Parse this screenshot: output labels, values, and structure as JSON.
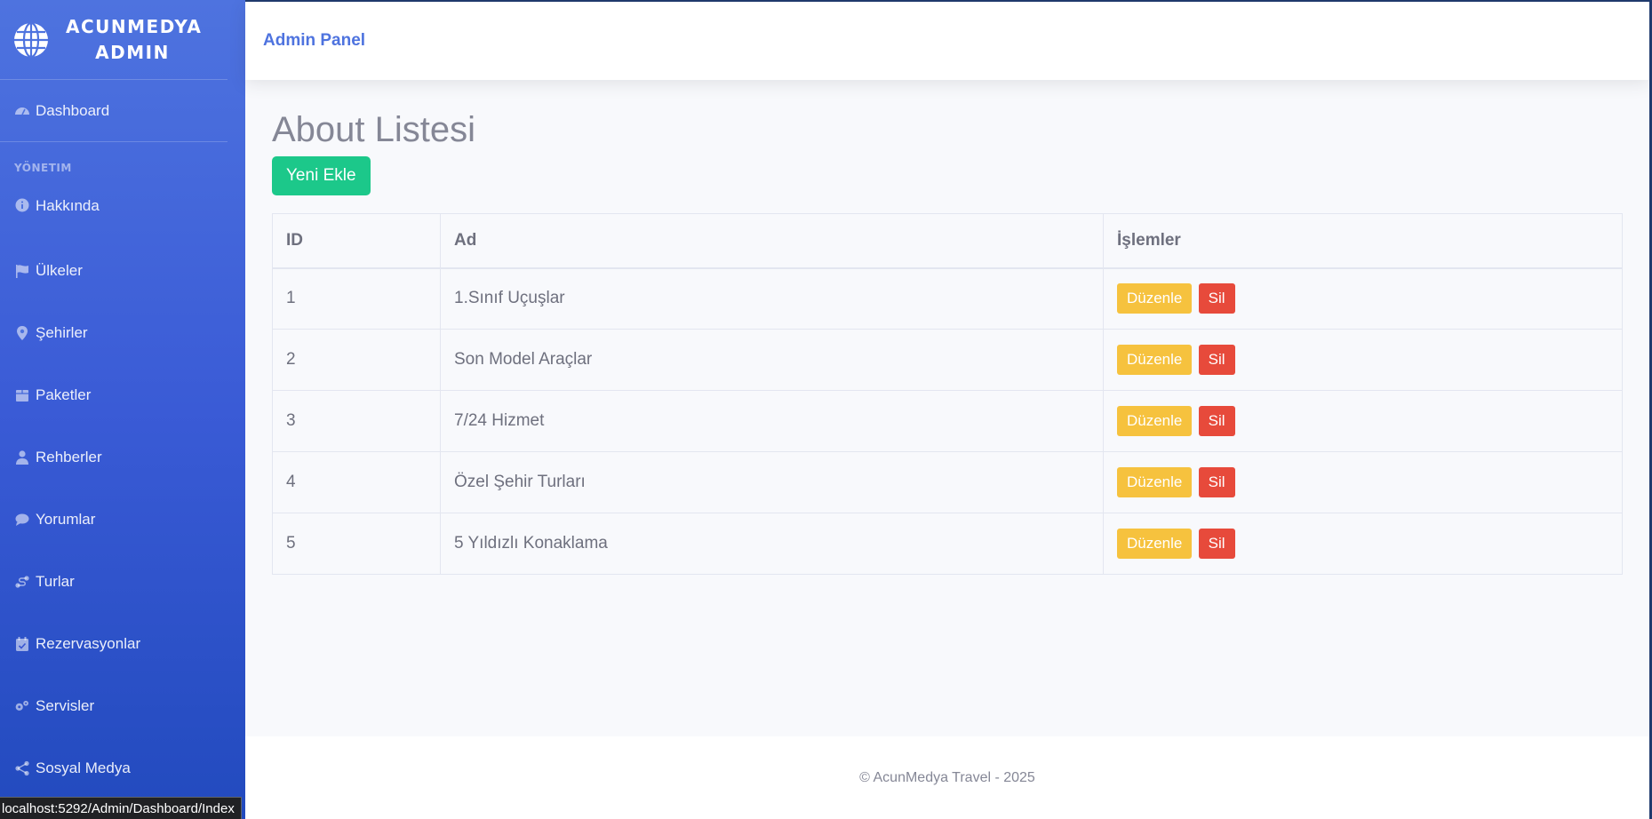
{
  "sidebar": {
    "brand_line1": "ACUNMEDYA",
    "brand_line2": "ADMIN",
    "dashboard": "Dashboard",
    "section_heading": "YÖNETIM",
    "items": [
      {
        "label": "Hakkında",
        "icon": "info-circle-icon"
      },
      {
        "label": "Ülkeler",
        "icon": "flag-icon"
      },
      {
        "label": "Şehirler",
        "icon": "map-marker-icon"
      },
      {
        "label": "Paketler",
        "icon": "box-icon"
      },
      {
        "label": "Rehberler",
        "icon": "user-tie-icon"
      },
      {
        "label": "Yorumlar",
        "icon": "comment-icon"
      },
      {
        "label": "Turlar",
        "icon": "route-icon"
      },
      {
        "label": "Rezervasyonlar",
        "icon": "calendar-check-icon"
      },
      {
        "label": "Servisler",
        "icon": "cogs-icon"
      },
      {
        "label": "Sosyal Medya",
        "icon": "share-icon"
      }
    ]
  },
  "topbar": {
    "title": "Admin Panel"
  },
  "main": {
    "title": "About Listesi",
    "add_button": "Yeni Ekle",
    "table": {
      "headers": [
        "ID",
        "Ad",
        "İşlemler"
      ],
      "edit_label": "Düzenle",
      "delete_label": "Sil",
      "rows": [
        {
          "id": "1",
          "ad": "1.Sınıf Uçuşlar"
        },
        {
          "id": "2",
          "ad": "Son Model Araçlar"
        },
        {
          "id": "3",
          "ad": "7/24 Hizmet"
        },
        {
          "id": "4",
          "ad": "Özel Şehir Turları"
        },
        {
          "id": "5",
          "ad": "5 Yıldızlı Konaklama"
        }
      ]
    }
  },
  "footer": {
    "text": "© AcunMedya Travel - 2025"
  },
  "statusbar": {
    "url": "localhost:5292/Admin/Dashboard/Index"
  },
  "colors": {
    "primary": "#4e73df",
    "success": "#1cc88a",
    "warning": "#f6c23e",
    "danger": "#e74a3b"
  }
}
